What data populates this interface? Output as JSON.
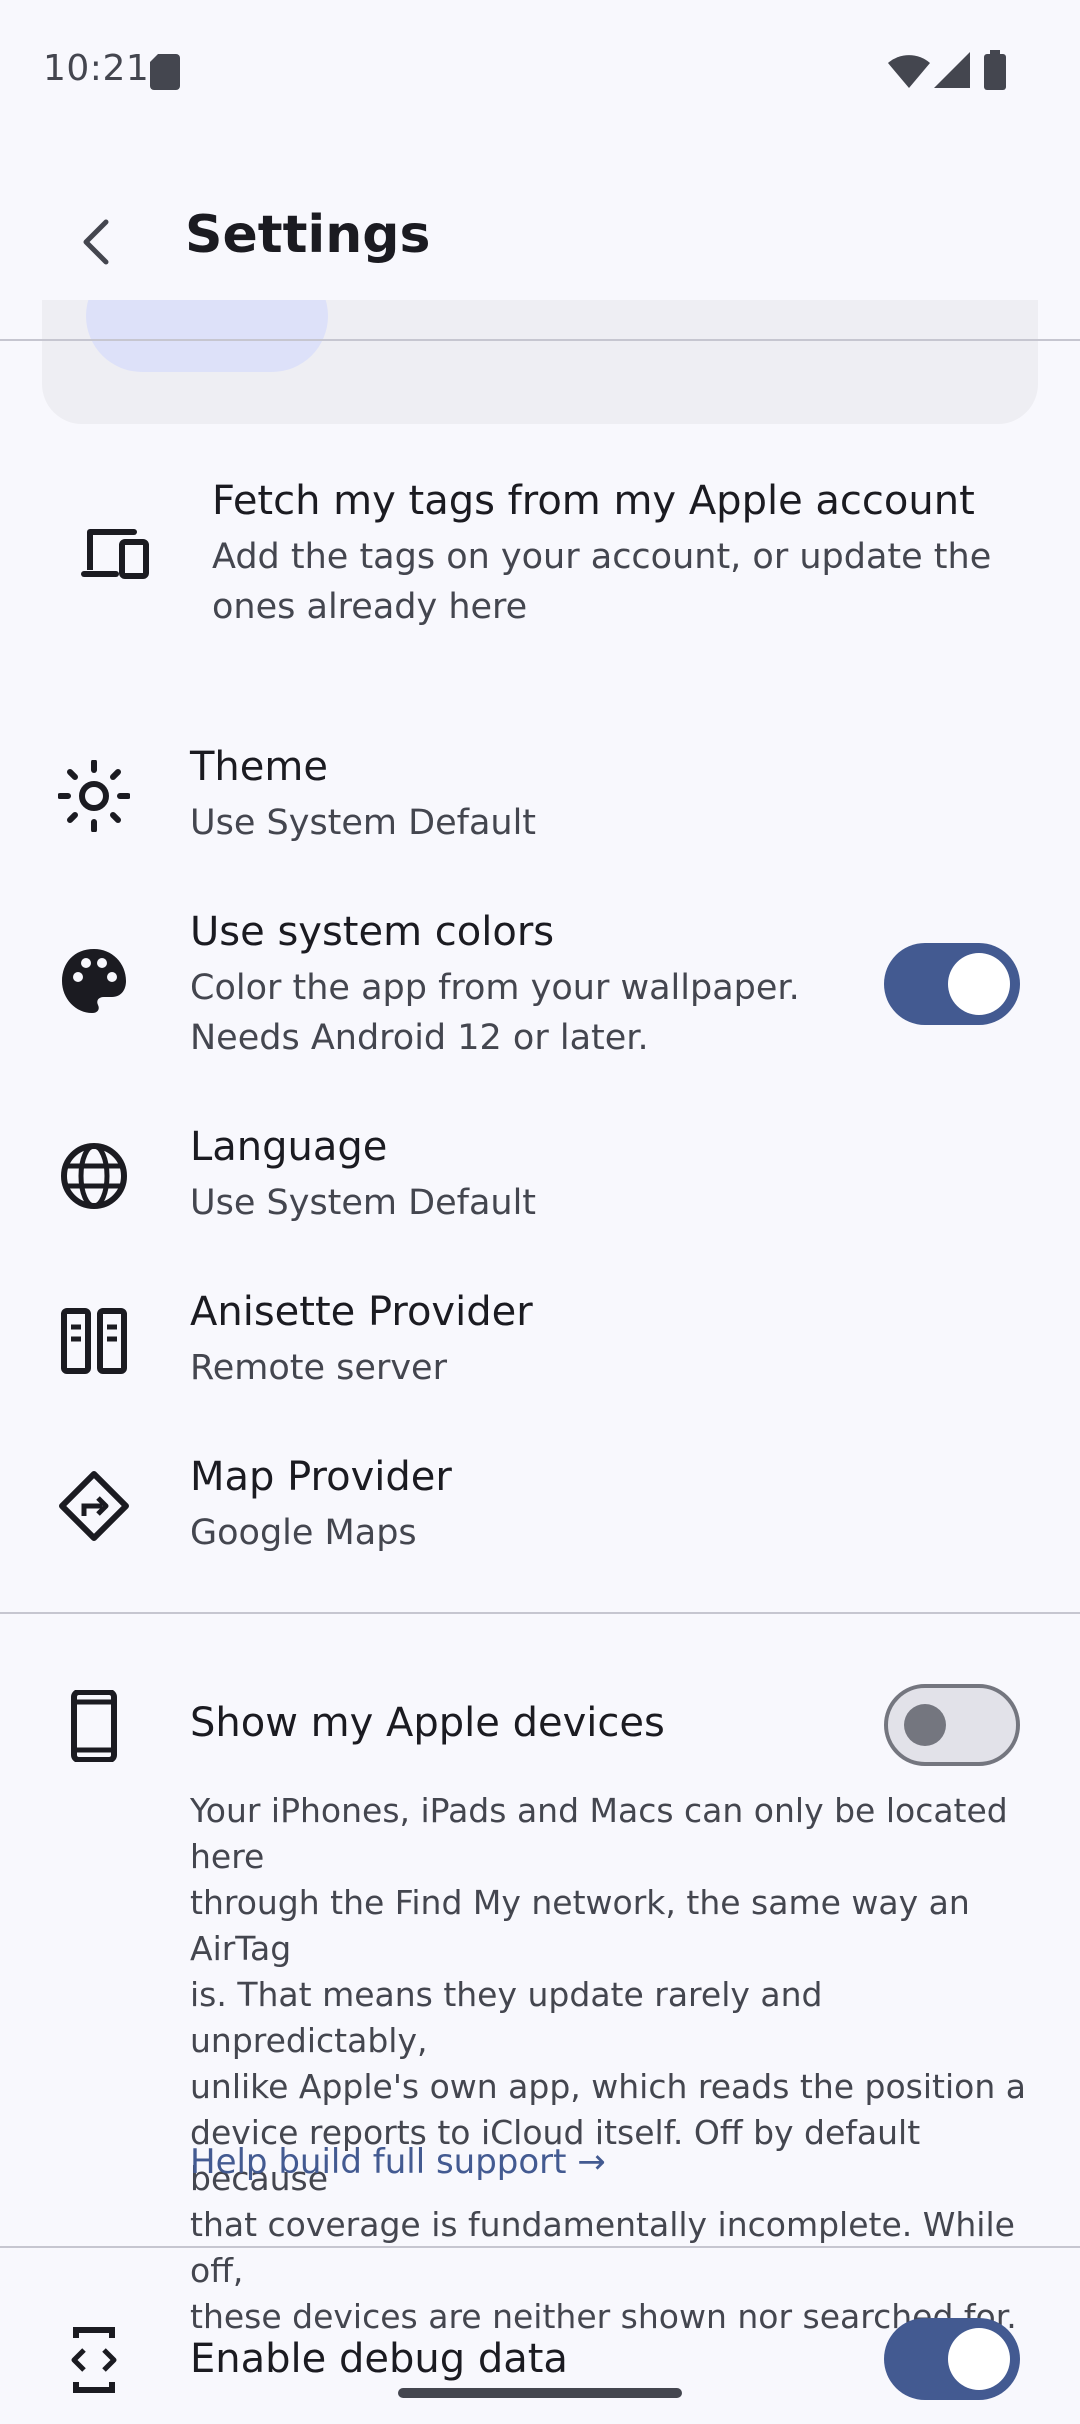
{
  "status_bar": {
    "time": "10:21",
    "icons": [
      "sd-card-icon",
      "wifi-icon",
      "signal-icon",
      "battery-icon"
    ]
  },
  "header": {
    "title": "Settings",
    "back_icon": "chevron-left-icon"
  },
  "fetch_tags": {
    "title": "Fetch my tags from my Apple account",
    "subtitle_line1": "Add the tags on your account, or update the",
    "subtitle_line2": "ones already here",
    "icon": "devices-icon"
  },
  "settings": [
    {
      "title": "Theme",
      "subtitle": "Use System Default",
      "icon": "brightness-icon"
    },
    {
      "title": "Use system colors",
      "subtitle_line1": "Color the app from your wallpaper.",
      "subtitle_line2": "Needs Android 12 or later.",
      "icon": "palette-icon",
      "toggle": true
    },
    {
      "title": "Language",
      "subtitle": "Use System Default",
      "icon": "globe-icon"
    },
    {
      "title": "Anisette Provider",
      "subtitle": "Remote server",
      "icon": "server-icon"
    },
    {
      "title": "Map Provider",
      "subtitle": "Google Maps",
      "icon": "directions-icon"
    }
  ],
  "apple_devices": {
    "title": "Show my Apple devices",
    "icon": "phone-icon",
    "toggle": false,
    "description": [
      "Your iPhones, iPads and Macs can only be located here",
      "through the Find My network, the same way an AirTag",
      "is. That means they update rarely and unpredictably,",
      "unlike Apple's own app, which reads the position a",
      "device reports to iCloud itself. Off by default because",
      "that coverage is fundamentally incomplete. While off,",
      "these devices are neither shown nor searched for."
    ],
    "link": "Help build full support →"
  },
  "debug": {
    "title": "Enable debug data",
    "icon": "developer-mode-icon",
    "toggle": true
  },
  "colors": {
    "accent": "#435a91",
    "background": "#f8f8fd",
    "divider": "#c6c6d0"
  }
}
